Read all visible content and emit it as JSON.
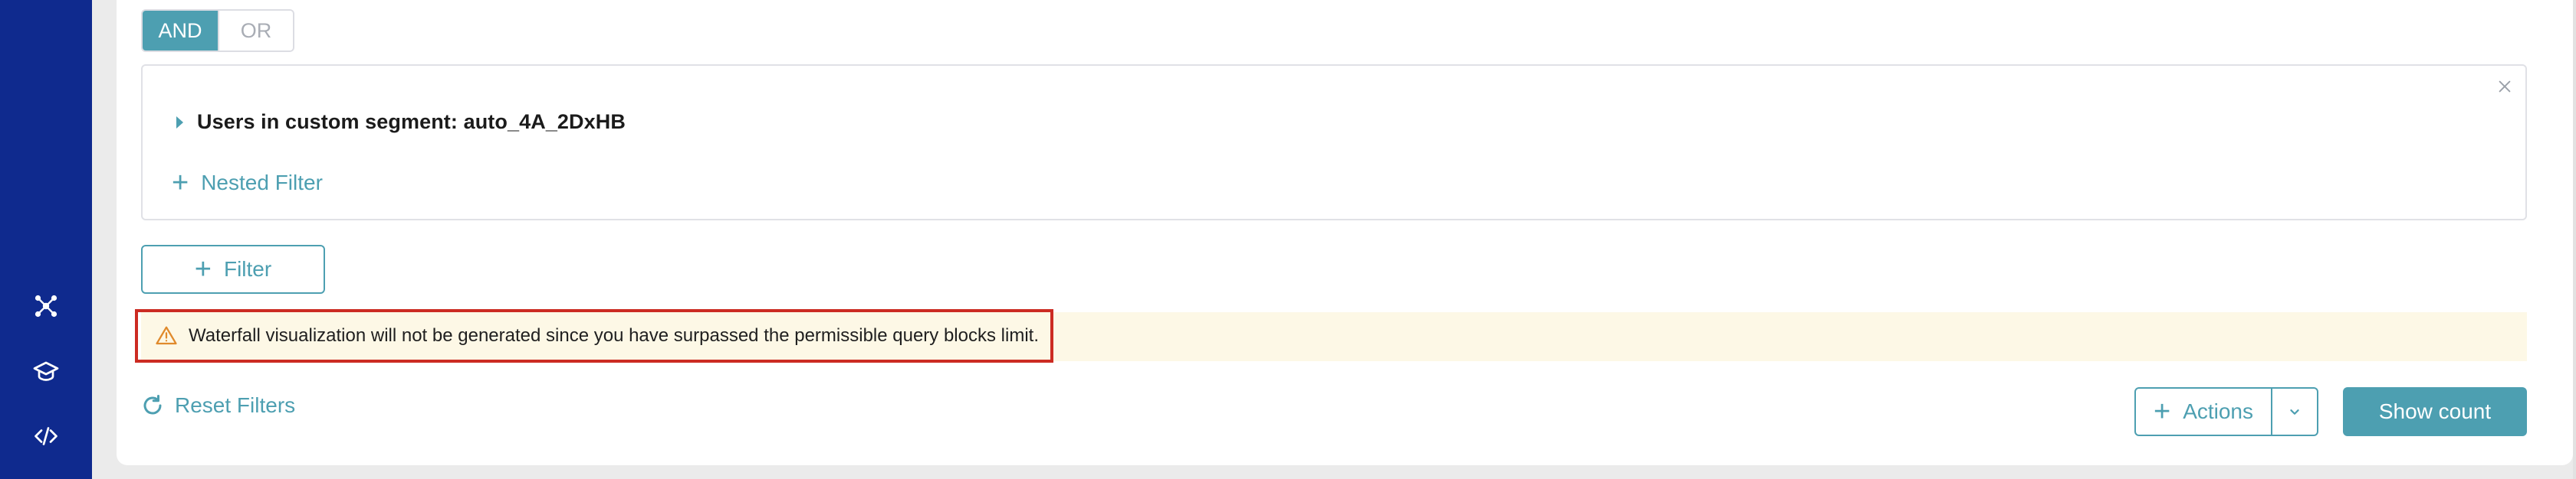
{
  "logic_toggle": {
    "and_label": "AND",
    "or_label": "OR",
    "selected": "AND"
  },
  "filter_group": {
    "segment_label": "Users in custom segment: auto_4A_2DxHB",
    "nested_filter_label": "Nested Filter"
  },
  "filter_button": {
    "label": "Filter"
  },
  "warning": {
    "text": "Waterfall visualization will not be generated since you have surpassed the permissible query blocks limit."
  },
  "reset_filters": {
    "label": "Reset Filters"
  },
  "actions": {
    "label": "Actions"
  },
  "show_count": {
    "label": "Show count"
  },
  "sidebar": {
    "icons": [
      "network-icon",
      "graduation-cap-icon",
      "code-icon"
    ]
  },
  "colors": {
    "sidebar": "#0f2a8e",
    "accent": "#4d9fb1",
    "warning_bg": "#fdf8e6",
    "warning_border": "#cc2b22"
  }
}
